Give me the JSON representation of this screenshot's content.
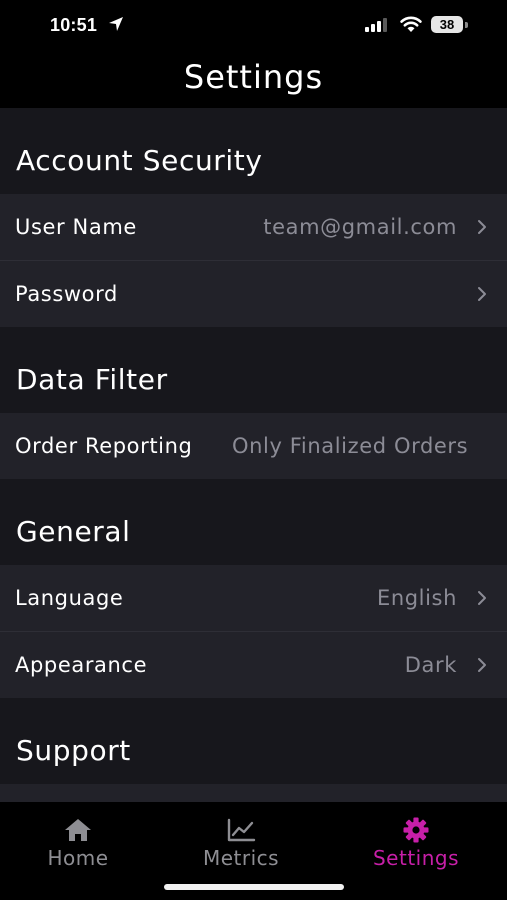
{
  "status_bar": {
    "time": "10:51",
    "battery": "38"
  },
  "header": {
    "title": "Settings"
  },
  "sections": {
    "account_security": {
      "title": "Account Security",
      "user_name_label": "User Name",
      "user_name_value": "team@gmail.com",
      "password_label": "Password"
    },
    "data_filter": {
      "title": "Data Filter",
      "order_reporting_label": "Order Reporting",
      "order_reporting_value": "Only Finalized Orders"
    },
    "general": {
      "title": "General",
      "language_label": "Language",
      "language_value": "English",
      "appearance_label": "Appearance",
      "appearance_value": "Dark"
    },
    "support": {
      "title": "Support"
    }
  },
  "tab_bar": {
    "tabs": [
      {
        "label": "Home",
        "icon": "home-icon",
        "active": false
      },
      {
        "label": "Metrics",
        "icon": "chart-line-icon",
        "active": false
      },
      {
        "label": "Settings",
        "icon": "gear-icon",
        "active": true
      }
    ]
  },
  "colors": {
    "background": "#17171c",
    "row_background": "#222229",
    "secondary_text": "#8c8c96",
    "inactive_tab": "#8e8e93",
    "accent": "#c71fa8"
  }
}
